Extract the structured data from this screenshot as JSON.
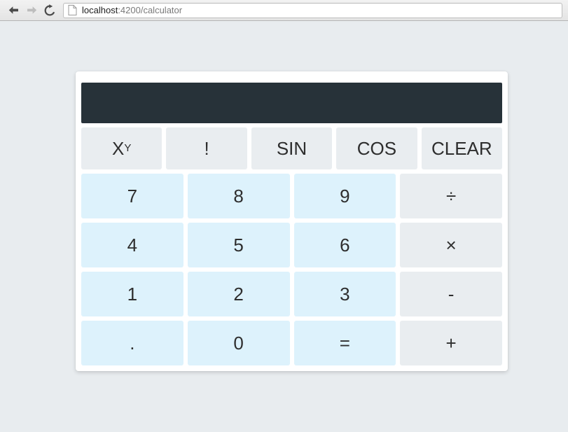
{
  "browser": {
    "back_icon": "back-arrow-icon",
    "forward_icon": "forward-arrow-icon",
    "reload_icon": "reload-icon",
    "page_icon": "page-document-icon",
    "url_host": "localhost",
    "url_path": ":4200/calculator",
    "url_full": "localhost:4200/calculator"
  },
  "calculator": {
    "display_value": "",
    "colors": {
      "display_bg": "#273239",
      "number_key_bg": "#ddf2fc",
      "operator_key_bg": "#e9edf0",
      "card_bg": "#ffffff",
      "page_bg": "#e8ecef",
      "key_text": "#2e2e2e"
    },
    "rows": [
      {
        "name": "function-row",
        "keys": [
          {
            "name": "power",
            "label": "X",
            "sup": "Y",
            "kind": "fn"
          },
          {
            "name": "factorial",
            "label": "!",
            "kind": "fn"
          },
          {
            "name": "sin",
            "label": "SIN",
            "kind": "fn"
          },
          {
            "name": "cos",
            "label": "COS",
            "kind": "fn"
          },
          {
            "name": "clear",
            "label": "CLEAR",
            "kind": "fn"
          }
        ]
      },
      {
        "name": "row-789",
        "keys": [
          {
            "name": "seven",
            "label": "7",
            "kind": "num"
          },
          {
            "name": "eight",
            "label": "8",
            "kind": "num"
          },
          {
            "name": "nine",
            "label": "9",
            "kind": "num"
          },
          {
            "name": "divide",
            "label": "÷",
            "kind": "op"
          }
        ]
      },
      {
        "name": "row-456",
        "keys": [
          {
            "name": "four",
            "label": "4",
            "kind": "num"
          },
          {
            "name": "five",
            "label": "5",
            "kind": "num"
          },
          {
            "name": "six",
            "label": "6",
            "kind": "num"
          },
          {
            "name": "multiply",
            "label": "×",
            "kind": "op"
          }
        ]
      },
      {
        "name": "row-123",
        "keys": [
          {
            "name": "one",
            "label": "1",
            "kind": "num"
          },
          {
            "name": "two",
            "label": "2",
            "kind": "num"
          },
          {
            "name": "three",
            "label": "3",
            "kind": "num"
          },
          {
            "name": "subtract",
            "label": "-",
            "kind": "op"
          }
        ]
      },
      {
        "name": "row-bottom",
        "keys": [
          {
            "name": "decimal",
            "label": ".",
            "kind": "num"
          },
          {
            "name": "zero",
            "label": "0",
            "kind": "num"
          },
          {
            "name": "equals",
            "label": "=",
            "kind": "num"
          },
          {
            "name": "add",
            "label": "+",
            "kind": "op"
          }
        ]
      }
    ]
  }
}
